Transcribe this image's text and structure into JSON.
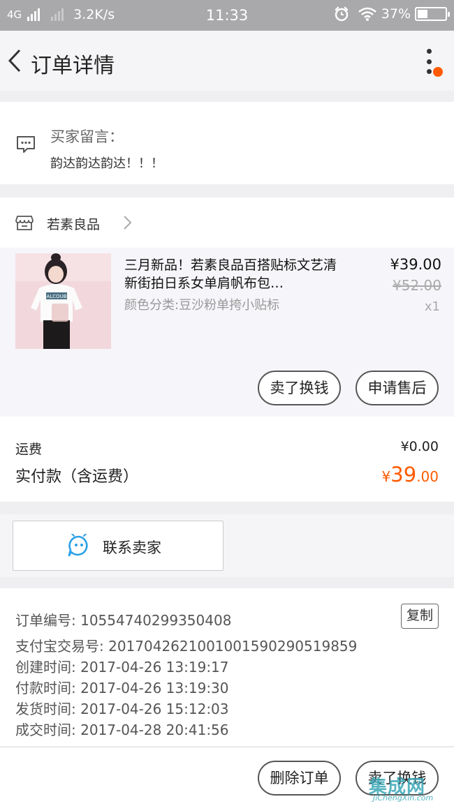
{
  "status_bar": {
    "network": "4G",
    "speed": "3.2K/s",
    "time": "11:33",
    "battery": "37%",
    "battery_level": 0.37
  },
  "nav": {
    "title": "订单详情"
  },
  "buyer_message": {
    "label": "买家留言：",
    "text": "韵达韵达韵达！！！"
  },
  "shop": {
    "name": "若素良品"
  },
  "item": {
    "title": "三月新品！若素良品百搭贴标文艺清新街拍日系女单肩帆布包…",
    "sku": "颜色分类:豆沙粉单挎小贴标",
    "price": "¥39.00",
    "original_price": "¥52.00",
    "quantity": "x1",
    "actions": [
      "卖了换钱",
      "申请售后"
    ],
    "image_text": "ALCOUB"
  },
  "summary": {
    "shipping_label": "运费",
    "shipping_value": "¥0.00",
    "paid_label": "实付款（含运费）",
    "paid_currency": "¥",
    "paid_integer": "39",
    "paid_decimal": ".00"
  },
  "contact": {
    "label": "联系卖家"
  },
  "order_info": {
    "copy_label": "复制",
    "rows": [
      "订单编号: 10554740299350408",
      "支付宝交易号: 2017042621001001590290519859",
      "创建时间: 2017-04-26 13:19:17",
      "付款时间: 2017-04-26 13:19:30",
      "发货时间: 2017-04-26 15:12:03",
      "成交时间: 2017-04-28 20:41:56"
    ]
  },
  "footer": {
    "actions": [
      "删除订单",
      "卖了换钱"
    ]
  },
  "watermark": {
    "main": "集成网",
    "sub": "JiChengXin.com"
  },
  "colors": {
    "accent": "#ff5a00",
    "status_bar": "#a9a9ab",
    "contact_icon": "#2aa0e8"
  }
}
